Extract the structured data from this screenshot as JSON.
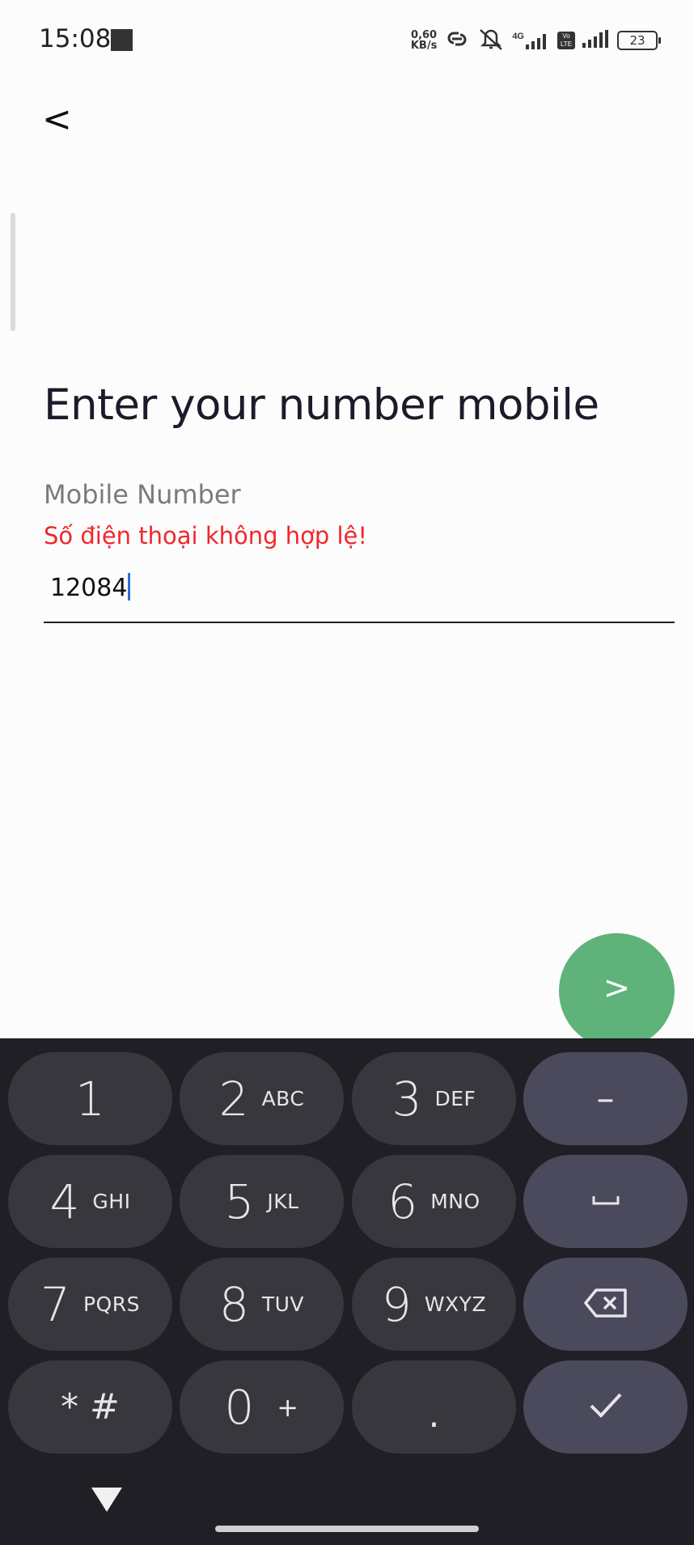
{
  "status_bar": {
    "time": "15:08",
    "net_speed_value": "0,60",
    "net_speed_unit": "KB/s",
    "signal_1_label": "4G",
    "volte_label": "Vo LTE",
    "battery": "23",
    "icons": [
      "link-icon",
      "mute-icon",
      "signal-icon",
      "volte-icon",
      "signal-icon",
      "battery-icon"
    ]
  },
  "header": {
    "back_label": "<"
  },
  "form": {
    "title": "Enter your number mobile",
    "field_label": "Mobile Number",
    "error_message": "Số điện thoại không hợp lệ!",
    "input_value": "12084",
    "submit_label": ">"
  },
  "keypad": {
    "keys": [
      {
        "digit": "1",
        "letters": ""
      },
      {
        "digit": "2",
        "letters": "ABC"
      },
      {
        "digit": "3",
        "letters": "DEF"
      },
      {
        "digit": "4",
        "letters": "GHI"
      },
      {
        "digit": "5",
        "letters": "JKL"
      },
      {
        "digit": "6",
        "letters": "MNO"
      },
      {
        "digit": "7",
        "letters": "PQRS"
      },
      {
        "digit": "8",
        "letters": "TUV"
      },
      {
        "digit": "9",
        "letters": "WXYZ"
      },
      {
        "digit": "* #",
        "letters": ""
      },
      {
        "digit": "0",
        "letters": "+"
      },
      {
        "digit": ".",
        "letters": ""
      }
    ],
    "side_keys": {
      "minus": "–",
      "space": "space-icon",
      "backspace": "backspace-icon",
      "done": "check-icon"
    }
  },
  "colors": {
    "background": "#fcfcfc",
    "error": "#f2262b",
    "fab": "#5fb27a",
    "keyboard_bg": "#1f1f25",
    "key_bg": "#37373d",
    "side_key_bg": "#4a4a5c",
    "caret": "#2a6fd8"
  }
}
